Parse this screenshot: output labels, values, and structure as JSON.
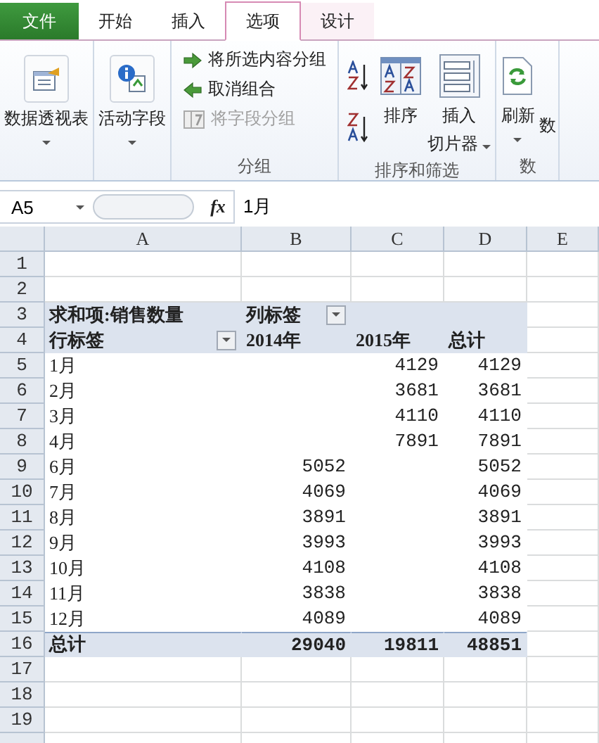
{
  "tabs": [
    {
      "label": "文件",
      "kind": "file",
      "selected": false
    },
    {
      "label": "开始",
      "kind": "normal",
      "selected": false
    },
    {
      "label": "插入",
      "kind": "normal",
      "selected": false
    },
    {
      "label": "选项",
      "kind": "contextual",
      "selected": true
    },
    {
      "label": "设计",
      "kind": "contextual",
      "selected": false
    }
  ],
  "ribbon": {
    "groups": [
      {
        "buttons": [
          {
            "kind": "large",
            "label": "数据透视表",
            "menu": true
          }
        ]
      },
      {
        "buttons": [
          {
            "kind": "large",
            "label": "活动字段",
            "menu": true
          }
        ]
      },
      {
        "title": "分组",
        "buttons": [
          {
            "kind": "small",
            "label": "将所选内容分组",
            "disabled": false
          },
          {
            "kind": "small",
            "label": "取消组合",
            "disabled": false
          },
          {
            "kind": "small",
            "label": "将字段分组",
            "disabled": true
          }
        ]
      },
      {
        "title": "排序和筛选",
        "buttons": [
          {
            "kind": "sortpair"
          },
          {
            "kind": "large",
            "label": "排序"
          },
          {
            "kind": "large",
            "label": "插入",
            "label2": "切片器",
            "menu": true
          }
        ]
      },
      {
        "title": "数",
        "buttons": [
          {
            "kind": "large",
            "label": "刷新",
            "menu": true
          },
          {
            "kind": "cut",
            "label": "数"
          }
        ]
      }
    ]
  },
  "formula_bar": {
    "name_box": "A5",
    "fx": "fx",
    "formula": "1月"
  },
  "sheet": {
    "columns": [
      "A",
      "B",
      "C",
      "D",
      "E"
    ],
    "row_numbers": [
      "1",
      "2",
      "3",
      "4",
      "5",
      "6",
      "7",
      "8",
      "9",
      "10",
      "11",
      "12",
      "13",
      "14",
      "15",
      "16",
      "17",
      "18",
      "19"
    ]
  },
  "pivot": {
    "title": "求和项:销售数量",
    "column_label": {
      "text": "列标签",
      "filter": true
    },
    "row_label": {
      "text": "行标签",
      "filter": true
    },
    "years": [
      "2014年",
      "2015年"
    ],
    "total_header": "总计",
    "rows": [
      {
        "label": "1月",
        "cells": {
          "2015": "4129"
        },
        "total": "4129"
      },
      {
        "label": "2月",
        "cells": {
          "2015": "3681"
        },
        "total": "3681"
      },
      {
        "label": "3月",
        "cells": {
          "2015": "4110"
        },
        "total": "4110"
      },
      {
        "label": "4月",
        "cells": {
          "2015": "7891"
        },
        "total": "7891"
      },
      {
        "label": "6月",
        "cells": {
          "2014": "5052"
        },
        "total": "5052"
      },
      {
        "label": "7月",
        "cells": {
          "2014": "4069"
        },
        "total": "4069"
      },
      {
        "label": "8月",
        "cells": {
          "2014": "3891"
        },
        "total": "3891"
      },
      {
        "label": "9月",
        "cells": {
          "2014": "3993"
        },
        "total": "3993"
      },
      {
        "label": "10月",
        "cells": {
          "2014": "4108"
        },
        "total": "4108"
      },
      {
        "label": "11月",
        "cells": {
          "2014": "3838"
        },
        "total": "3838"
      },
      {
        "label": "12月",
        "cells": {
          "2014": "4089"
        },
        "total": "4089"
      }
    ],
    "grand_total": {
      "label": "总计",
      "cells": {
        "2014": "29040",
        "2015": "19811"
      },
      "total": "48851"
    }
  }
}
